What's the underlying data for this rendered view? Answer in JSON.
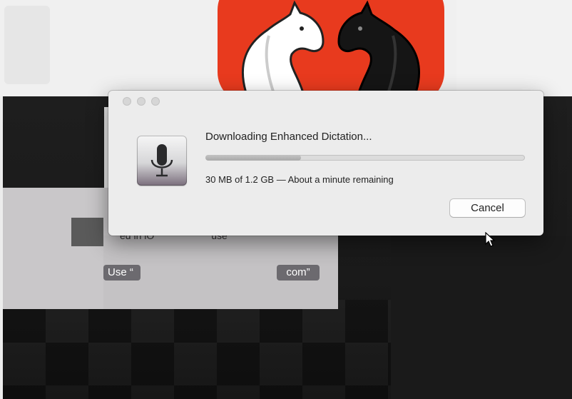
{
  "dialog": {
    "title": "Downloading Enhanced Dictation...",
    "progress_fraction": 0.3,
    "status": "30 MB of 1.2 GB — About a minute remaining",
    "cancel_label": "Cancel",
    "icon": "microphone-icon"
  },
  "background_dialog": {
    "text_fragment_left": "ed in iO",
    "text_fragment_right": "use",
    "button_left_label": "Use “",
    "button_right_label": "com”"
  },
  "app_icon": {
    "name": "chess-knights-icon",
    "color": "#e83a1e"
  },
  "colors": {
    "dialog_bg": "#ececec",
    "desktop_dark": "#1e1e1e"
  }
}
